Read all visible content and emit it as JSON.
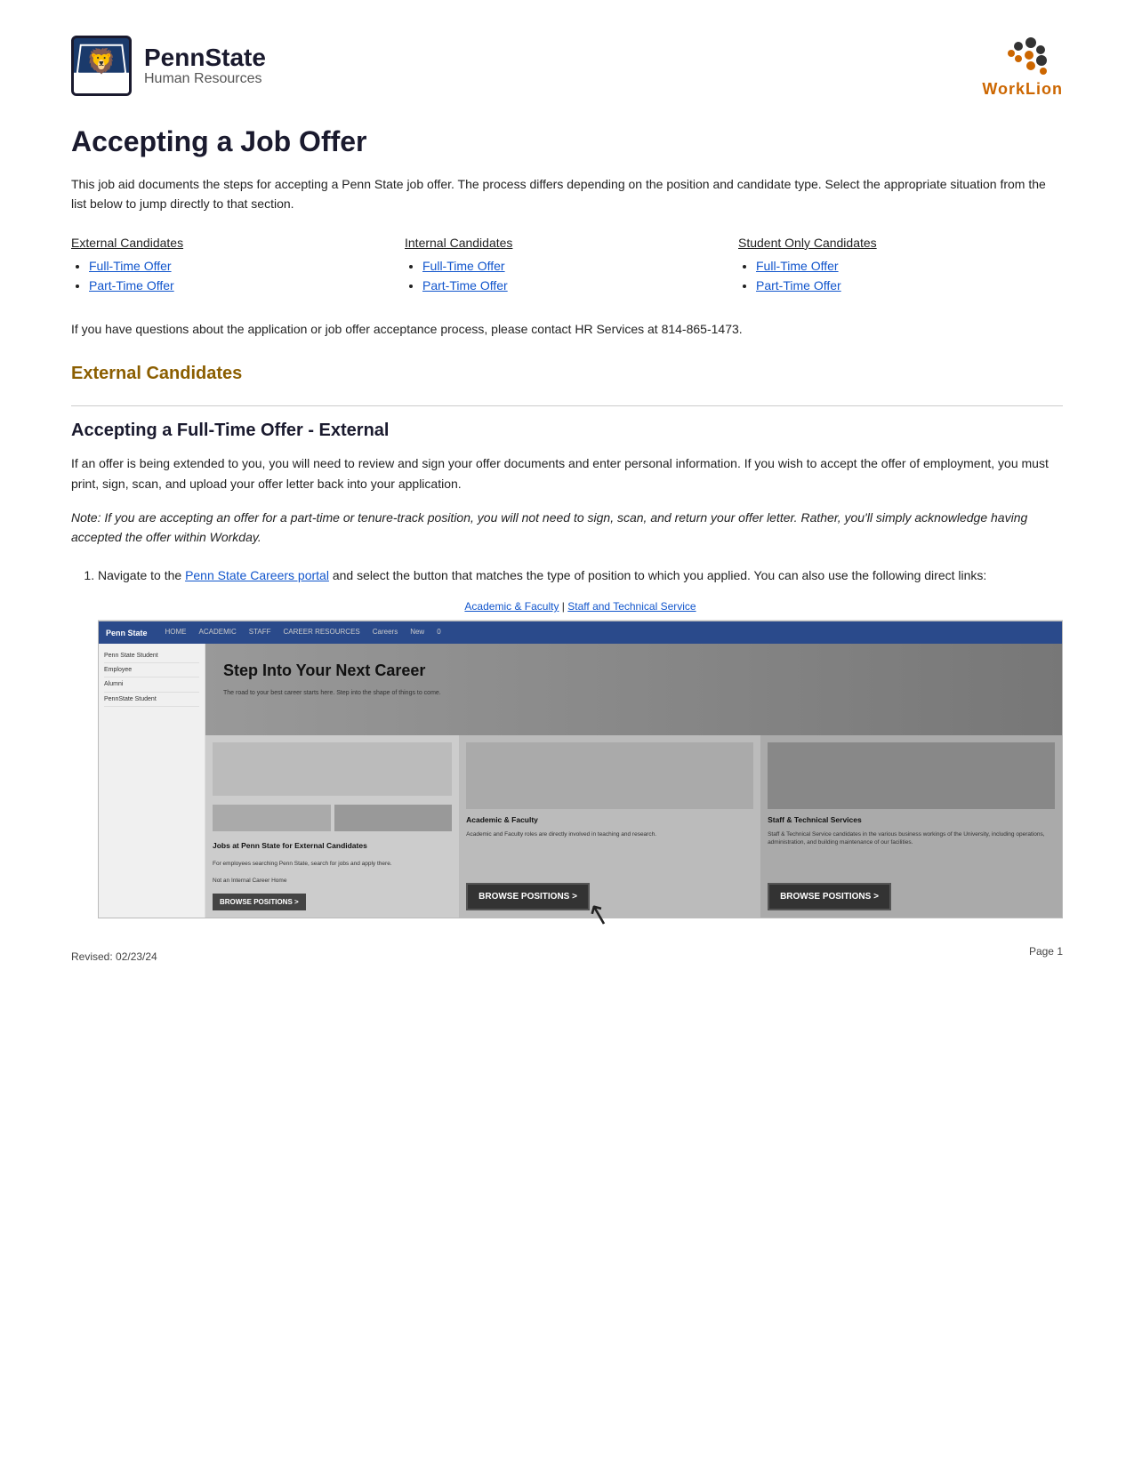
{
  "header": {
    "pennstate_title": "PennState",
    "pennstate_subtitle": "Human Resources",
    "worklion_label1": "Work",
    "worklion_label2": "Lion"
  },
  "page": {
    "title": "Accepting a Job Offer",
    "intro": "This job aid documents the steps for accepting a Penn State job offer. The process differs depending on the position and candidate type. Select the appropriate situation from the list below to jump directly to that section.",
    "contact_text": "If you have questions about the application or job offer acceptance process, please contact HR Services at 814-865-1473.",
    "revised": "Revised: 02/23/24",
    "page_num": "Page 1"
  },
  "candidates": {
    "external": {
      "header": "External Candidates",
      "items": [
        "Full-Time Offer",
        "Part-Time Offer"
      ]
    },
    "internal": {
      "header": "Internal Candidates",
      "items": [
        "Full-Time Offer",
        "Part-Time Offer"
      ]
    },
    "student": {
      "header": "Student Only Candidates",
      "items": [
        "Full-Time Offer",
        "Part-Time Offer"
      ]
    }
  },
  "sections": {
    "external_section_title": "External Candidates",
    "full_time_title": "Accepting a Full-Time Offer - External",
    "full_time_desc": "If an offer is being extended to you, you will need to review and sign your offer documents and enter personal information. If you wish to accept the offer of employment, you must print, sign, scan, and upload your offer letter back into your application.",
    "note_text": "Note: If you are accepting an offer for a part-time or tenure-track position, you will not need to sign, scan, and return your offer letter. Rather, you'll simply acknowledge having accepted the offer within Workday.",
    "step1_prefix": "Navigate to the ",
    "step1_portal_text": "Penn State Careers portal",
    "step1_suffix": " and select the button that matches the type of position to which you applied. You can also use the following direct links:",
    "screenshot_link1": "Academic & Faculty",
    "screenshot_separator": " | ",
    "screenshot_link2": "Staff and Technical Service"
  },
  "screenshot": {
    "nav_logo": "Penn State",
    "nav_items": [
      "HOME",
      "ACADEMIC",
      "STAFF",
      "CAREER RESOURCES",
      "Careers",
      "New",
      "0"
    ],
    "hero_title": "Step Into Your Next Career",
    "hero_desc": "The road to your best career starts here. Step into the shape of things to come.",
    "section_left_title": "Jobs at Penn State for External Candidates",
    "section_left_desc": "For employees searching Penn State, search for jobs and apply there.",
    "section_left_small": "Not an Internal Career Home",
    "section_left_btn": "BROWSE POSITIONS >",
    "section_center_title": "Academic & Faculty",
    "section_center_desc": "Academic and Faculty roles are directly involved in teaching and research.",
    "section_center_btn": "BROWSE POSITIONS >",
    "section_right_title": "Staff & Technical Services",
    "section_right_desc": "Staff & Technical Service candidates in the various business workings of the University, including operations, administration, and building maintenance of our facilities.",
    "section_right_btn": "BROWSE POSITIONS >"
  },
  "sidebar": {
    "items": [
      "Penn State Student",
      "Employee"
    ]
  }
}
